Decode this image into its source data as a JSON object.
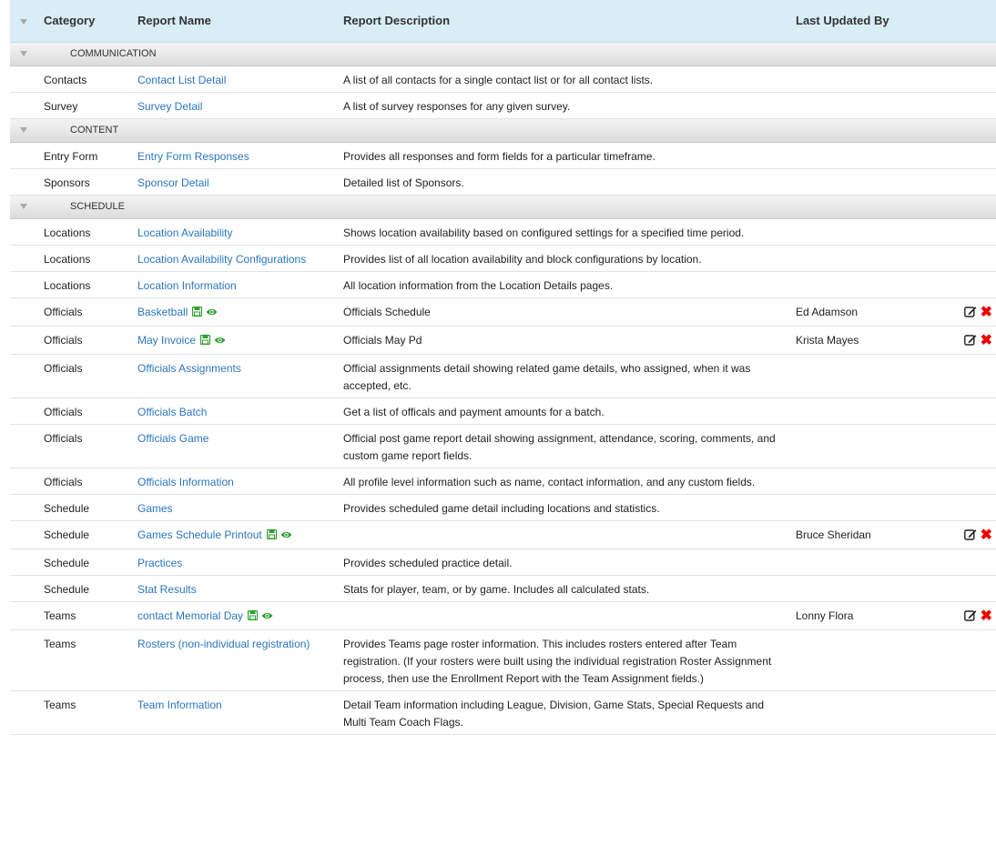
{
  "header": {
    "category": "Category",
    "report_name": "Report Name",
    "report_description": "Report Description",
    "last_updated_by": "Last Updated By"
  },
  "groups": [
    {
      "name": "COMMUNICATION",
      "rows": [
        {
          "category": "Contacts",
          "name": "Contact List Detail",
          "description": "A list of all contacts for a single contact list or for all contact lists.",
          "updated_by": "",
          "saved": false
        },
        {
          "category": "Survey",
          "name": "Survey Detail",
          "description": "A list of survey responses for any given survey.",
          "updated_by": "",
          "saved": false
        }
      ]
    },
    {
      "name": "CONTENT",
      "rows": [
        {
          "category": "Entry Form",
          "name": "Entry Form Responses",
          "description": "Provides all responses and form fields for a particular timeframe.",
          "updated_by": "",
          "saved": false
        },
        {
          "category": "Sponsors",
          "name": "Sponsor Detail",
          "description": "Detailed list of Sponsors.",
          "updated_by": "",
          "saved": false
        }
      ]
    },
    {
      "name": "SCHEDULE",
      "rows": [
        {
          "category": "Locations",
          "name": "Location Availability",
          "description": "Shows location availability based on configured settings for a specified time period.",
          "updated_by": "",
          "saved": false
        },
        {
          "category": "Locations",
          "name": "Location Availability Configurations",
          "description": "Provides list of all location availability and block configurations by location.",
          "updated_by": "",
          "saved": false
        },
        {
          "category": "Locations",
          "name": "Location Information",
          "description": "All location information from the Location Details pages.",
          "updated_by": "",
          "saved": false
        },
        {
          "category": "Officials",
          "name": "Basketball",
          "description": "Officials Schedule",
          "updated_by": "Ed Adamson",
          "saved": true
        },
        {
          "category": "Officials",
          "name": "May Invoice",
          "description": "Officials May Pd",
          "updated_by": "Krista Mayes",
          "saved": true
        },
        {
          "category": "Officials",
          "name": "Officials Assignments",
          "description": "Official assignments detail showing related game details, who assigned, when it was accepted, etc.",
          "updated_by": "",
          "saved": false
        },
        {
          "category": "Officials",
          "name": "Officials Batch",
          "description": "Get a list of officals and payment amounts for a batch.",
          "updated_by": "",
          "saved": false
        },
        {
          "category": "Officials",
          "name": "Officials Game",
          "description": "Official post game report detail showing assignment, attendance, scoring, comments, and custom game report fields.",
          "updated_by": "",
          "saved": false
        },
        {
          "category": "Officials",
          "name": "Officials Information",
          "description": "All profile level information such as name, contact information, and any custom fields.",
          "updated_by": "",
          "saved": false
        },
        {
          "category": "Schedule",
          "name": "Games",
          "description": "Provides scheduled game detail including locations and statistics.",
          "updated_by": "",
          "saved": false
        },
        {
          "category": "Schedule",
          "name": "Games Schedule Printout",
          "description": "",
          "updated_by": "Bruce Sheridan",
          "saved": true
        },
        {
          "category": "Schedule",
          "name": "Practices",
          "description": "Provides scheduled practice detail.",
          "updated_by": "",
          "saved": false
        },
        {
          "category": "Schedule",
          "name": "Stat Results",
          "description": "Stats for player, team, or by game. Includes all calculated stats.",
          "updated_by": "",
          "saved": false
        },
        {
          "category": "Teams",
          "name": "contact Memorial Day",
          "description": "",
          "updated_by": "Lonny Flora",
          "saved": true
        },
        {
          "category": "Teams",
          "name": "Rosters (non-individual registration)",
          "description": "Provides Teams page roster information. This includes rosters entered after Team registration. (If your rosters were built using the individual registration Roster Assignment process, then use the Enrollment Report with the Team Assignment fields.)",
          "updated_by": "",
          "saved": false
        },
        {
          "category": "Teams",
          "name": "Team Information",
          "description": "Detail Team information including League, Division, Game Stats, Special Requests and Multi Team Coach Flags.",
          "updated_by": "",
          "saved": false
        }
      ]
    }
  ],
  "colors": {
    "header_bg": "#d9edf7",
    "link": "#2a76bf",
    "delete": "#e00000",
    "saved_icon": "#2e9e2e"
  },
  "icons": {
    "collapse": "caret-down-icon",
    "saved": "floppy-disk-icon",
    "view": "eye-icon",
    "edit": "edit-icon",
    "delete": "delete-x-icon"
  }
}
